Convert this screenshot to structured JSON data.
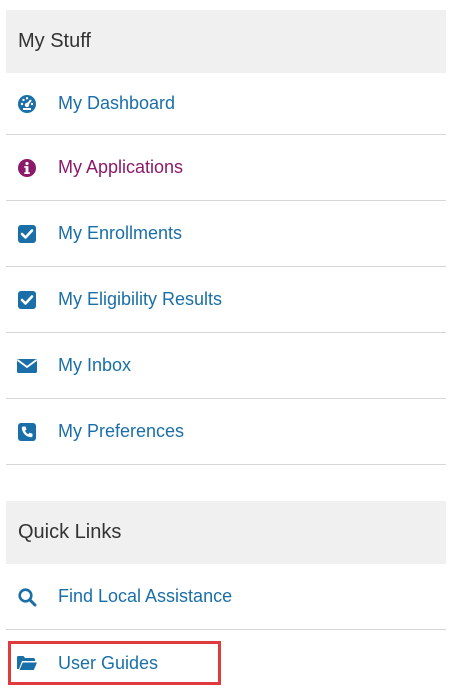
{
  "my_stuff": {
    "title": "My Stuff",
    "items": [
      {
        "label": "My Dashboard",
        "icon": "dashboard-icon",
        "color": "#1a6fa8"
      },
      {
        "label": "My Applications",
        "icon": "info-circle-icon",
        "color": "#8b1a6b"
      },
      {
        "label": "My Enrollments",
        "icon": "checkbox-icon",
        "color": "#1a6fa8"
      },
      {
        "label": "My Eligibility Results",
        "icon": "checkbox-icon",
        "color": "#1a6fa8"
      },
      {
        "label": "My Inbox",
        "icon": "envelope-icon",
        "color": "#1a6fa8"
      },
      {
        "label": "My Preferences",
        "icon": "phone-icon",
        "color": "#1a6fa8"
      }
    ]
  },
  "quick_links": {
    "title": "Quick Links",
    "items": [
      {
        "label": "Find Local Assistance",
        "icon": "search-icon",
        "color": "#1a6fa8"
      },
      {
        "label": "User Guides",
        "icon": "folder-open-icon",
        "color": "#1a6fa8"
      }
    ]
  },
  "colors": {
    "link": "#1a6fa8",
    "active_link": "#8b1a6b",
    "header_bg": "#f0f0f0",
    "highlight": "#e0393e"
  }
}
